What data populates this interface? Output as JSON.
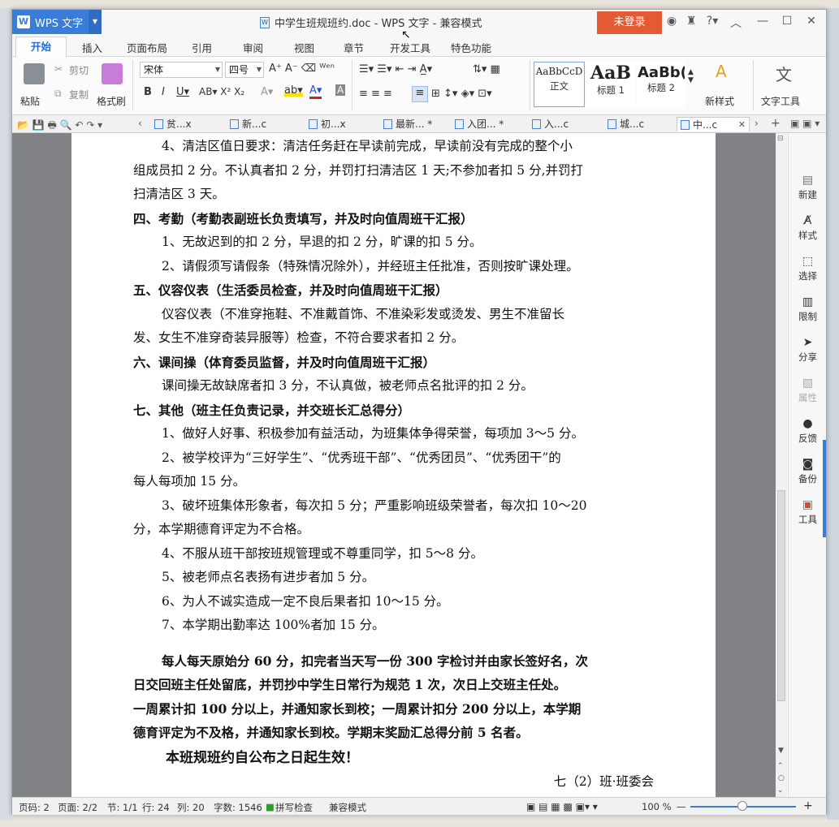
{
  "titlebar": {
    "app_name": "WPS 文字",
    "doc_title": "中学生班规班约.doc - WPS 文字 - 兼容模式",
    "login": "未登录"
  },
  "ribbon_tabs": [
    "开始",
    "插入",
    "页面布局",
    "引用",
    "审阅",
    "视图",
    "章节",
    "开发工具",
    "特色功能"
  ],
  "ribbon": {
    "paste": "粘贴",
    "cut": "剪切",
    "copy": "复制",
    "format_painter": "格式刷",
    "font_name": "宋体",
    "font_size": "四号",
    "styles": [
      {
        "sample": "AaBbCcD",
        "label": "正文"
      },
      {
        "sample": "AaB",
        "label": "标题 1"
      },
      {
        "sample": "AaBb(",
        "label": "标题 2"
      }
    ],
    "new_style": "新样式",
    "text_tools": "文字工具"
  },
  "doc_tabs": [
    "贫...x",
    "新...c",
    "初...x",
    "最新... *",
    "入团... *",
    "入...c",
    "城...c",
    "中...c"
  ],
  "document": {
    "lines": [
      {
        "text": "4、清洁区值日要求：清洁任务赶在早读前完成，早读前没有完成的整个小",
        "cls": "ind"
      },
      {
        "text": "组成员扣 2 分。不认真者扣 2 分，并罚打扫清洁区 1 天;不参加者扣 5 分,并罚打",
        "cls": ""
      },
      {
        "text": "扫清洁区 3 天。",
        "cls": ""
      },
      {
        "text": "四、考勤（考勤表副班长负责填写，并及时向值周班干汇报）",
        "cls": "h"
      },
      {
        "text": "1、无故迟到的扣 2 分，早退的扣 2 分，旷课的扣 5 分。",
        "cls": "ind"
      },
      {
        "text": "2、请假须写请假条（特殊情况除外），并经班主任批准，否则按旷课处理。",
        "cls": "ind"
      },
      {
        "text": "五、仪容仪表（生活委员检查，并及时向值周班干汇报）",
        "cls": "h"
      },
      {
        "text": "仪容仪表（不准穿拖鞋、不准戴首饰、不准染彩发或烫发、男生不准留长",
        "cls": "ind"
      },
      {
        "text": "发、女生不准穿奇装异服等）检查，不符合要求者扣 2 分。",
        "cls": ""
      },
      {
        "text": "六、课间操（体育委员监督，并及时向值周班干汇报）",
        "cls": "h"
      },
      {
        "text": "课间操无故缺席者扣 3 分，不认真做，被老师点名批评的扣 2 分。",
        "cls": "ind"
      },
      {
        "text": "七、其他（班主任负责记录，并交班长汇总得分）",
        "cls": "h"
      },
      {
        "text": "1、做好人好事、积极参加有益活动，为班集体争得荣誉，每项加 3～5 分。",
        "cls": "ind"
      },
      {
        "text": "2、被学校评为“三好学生”、“优秀班干部”、“优秀团员”、“优秀团干”的",
        "cls": "ind"
      },
      {
        "text": "每人每项加 15 分。",
        "cls": ""
      },
      {
        "text": "3、破坏班集体形象者，每次扣 5 分；严重影响班级荣誉者，每次扣 10～20",
        "cls": "ind"
      },
      {
        "text": "分，本学期德育评定为不合格。",
        "cls": ""
      },
      {
        "text": "4、不服从班干部按班规管理或不尊重同学，扣 5～8 分。",
        "cls": "ind"
      },
      {
        "text": "5、被老师点名表扬有进步者加 5 分。",
        "cls": "ind"
      },
      {
        "text": "6、为人不诚实造成一定不良后果者扣 10～15 分。",
        "cls": "ind"
      },
      {
        "text": "7、本学期出勤率达 100%者加 15 分。",
        "cls": "ind"
      }
    ],
    "summary": [
      {
        "text": "每人每天原始分 60 分，扣完者当天写一份 300 字检讨并由家长签好名，次",
        "cls": "bold ind gap"
      },
      {
        "text": "日交回班主任处留底，并罚抄中学生日常行为规范 1 次，次日上交班主任处。",
        "cls": "bold"
      },
      {
        "text": "一周累计扣 100 分以上，并通知家长到校；一周累计扣分 200 分以上，本学期",
        "cls": "bold"
      },
      {
        "text": "德育评定为不及格，并通知家长到校。学期末奖励汇总得分前 5 名者。",
        "cls": "bold"
      }
    ],
    "effective": "本班规班约自公布之日起生效！",
    "signature": "七（2）班·班委会"
  },
  "side_panel": [
    "新建",
    "样式",
    "选择",
    "限制",
    "分享",
    "属性",
    "反馈",
    "备份",
    "工具"
  ],
  "status": {
    "page_num": "页码: 2",
    "pages": "页面: 2/2",
    "section": "节: 1/1",
    "row": "行: 24",
    "col": "列: 20",
    "words": "字数: 1546",
    "spell": "拼写检查",
    "compat": "兼容模式",
    "zoom": "100 %"
  },
  "colors": {
    "accent": "#3a7dd8",
    "login": "#e45a35"
  }
}
